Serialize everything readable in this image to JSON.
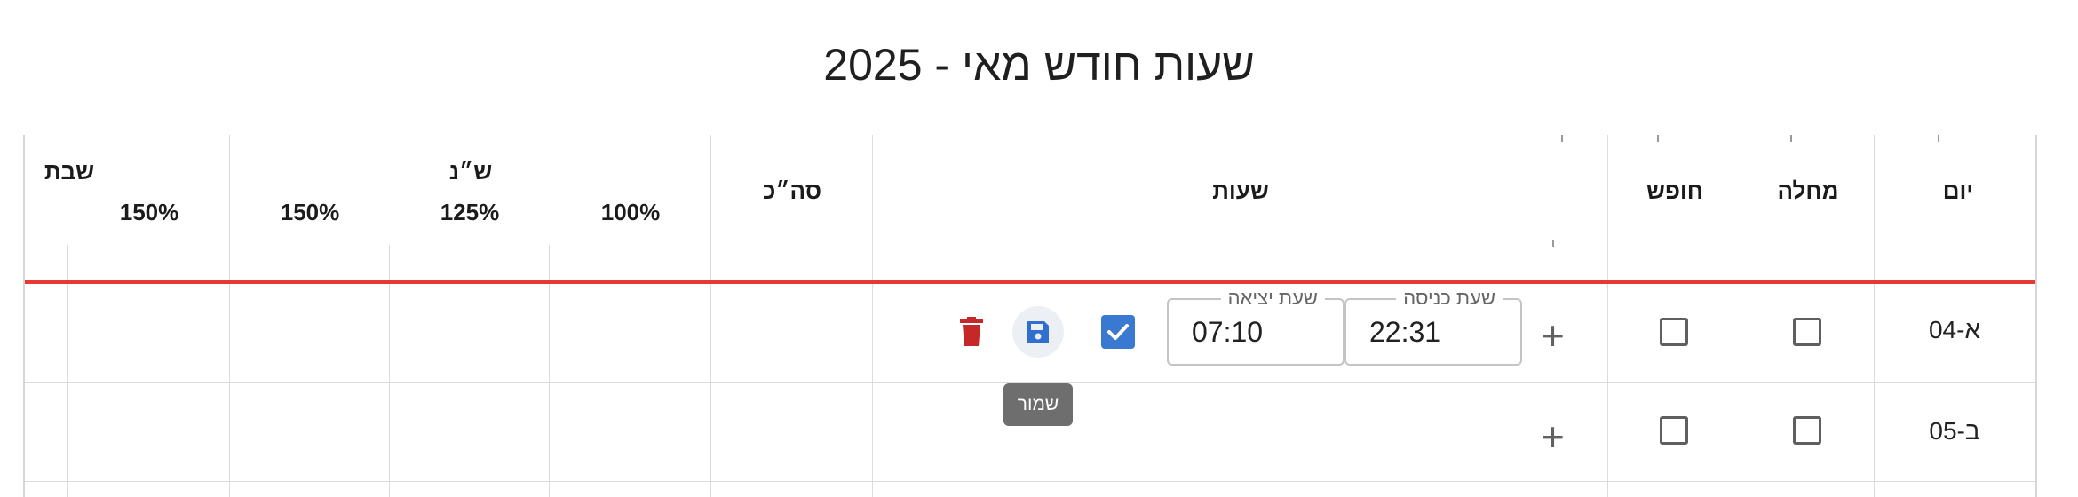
{
  "page_title": "שעות חודש מאי - 2025",
  "columns": {
    "day": "יום",
    "sick": "מחלה",
    "vacation": "חופש",
    "hours": "שעות",
    "total": "סה״כ",
    "overtime_group": "ש״נ",
    "ot_100": "100%",
    "ot_125": "125%",
    "ot_150": "150%",
    "shabbat_group": "שבת",
    "shabbat_150": "150%"
  },
  "rows": [
    {
      "day": "א-04",
      "entry_label": "שעת כניסה",
      "entry_value": "22:31",
      "exit_label": "שעת יציאה",
      "exit_value": "07:10",
      "add_symbol": "+"
    },
    {
      "day": "ב-05",
      "add_symbol": "+"
    }
  ],
  "tooltip": {
    "save": "שמור"
  },
  "colors": {
    "accent_red": "#e53935",
    "checkbox_blue": "#3a79d1",
    "save_icon_blue": "#2f6fd0",
    "trash_red": "#c62828"
  }
}
